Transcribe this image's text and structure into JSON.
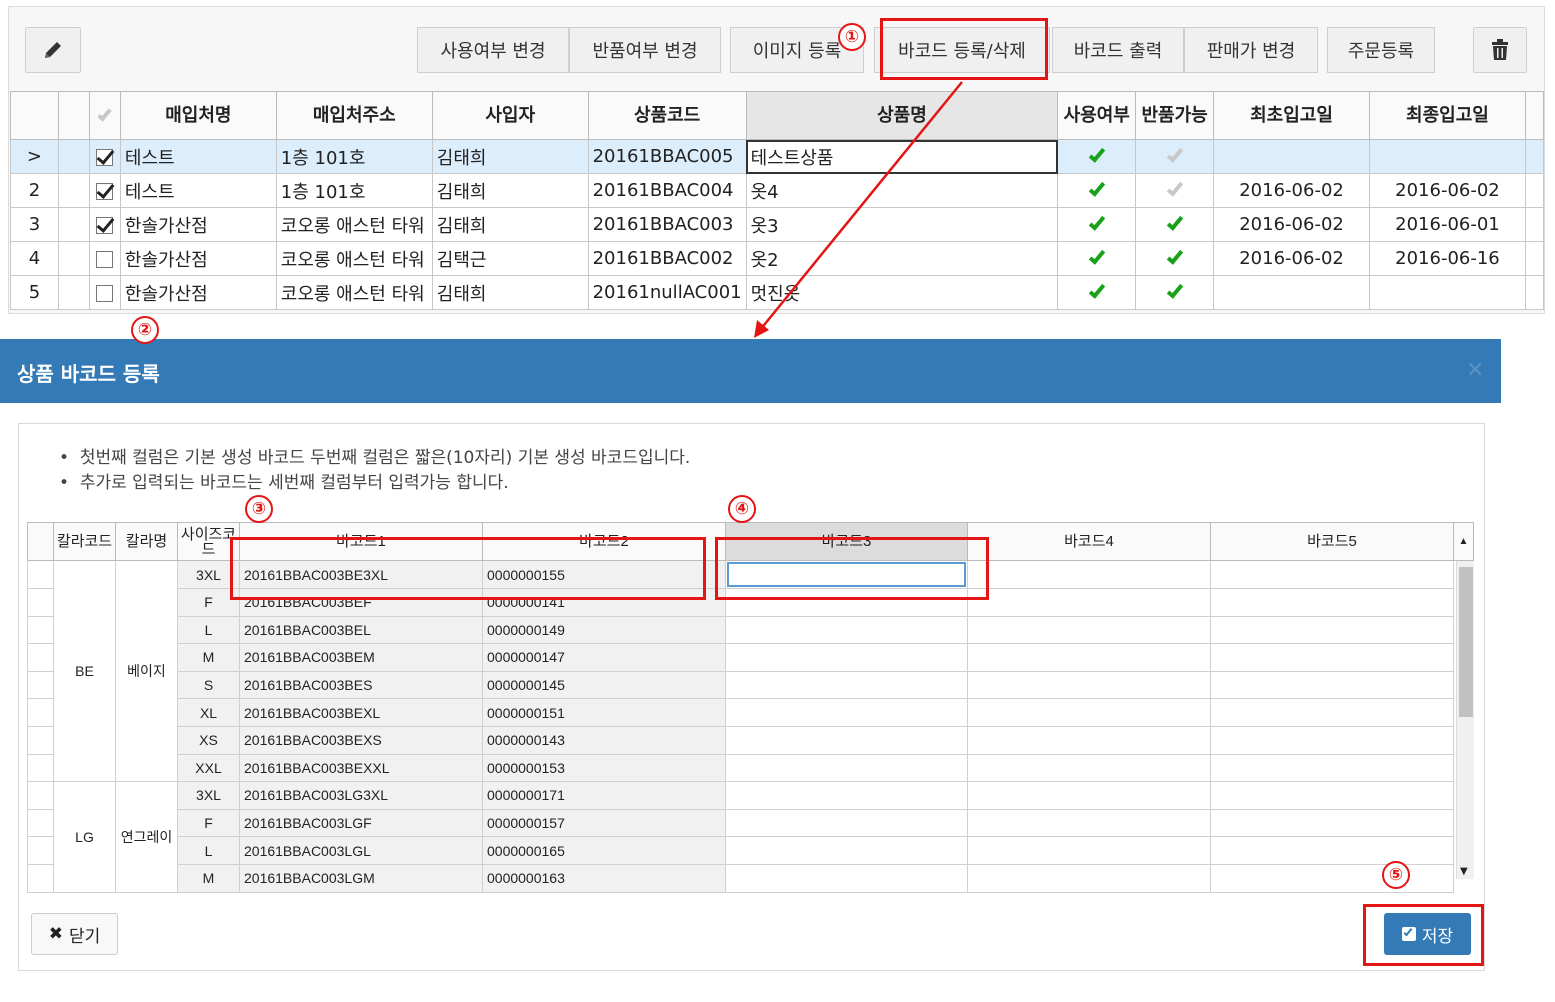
{
  "toolbar": {
    "edit_icon": "pencil-icon",
    "delete_icon": "trash-icon",
    "buttons": [
      "사용여부 변경",
      "반품여부 변경",
      "이미지 등록",
      "바코드 등록/삭제",
      "바코드 출력",
      "판매가 변경",
      "주문등록"
    ]
  },
  "product_grid": {
    "columns": [
      "매입처명",
      "매입처주소",
      "사입자",
      "상품코드",
      "상품명",
      "사용여부",
      "반품가능",
      "최초입고일",
      "최종입고일"
    ],
    "rows": [
      {
        "row_no": ">",
        "checked": true,
        "vendor": "테스트",
        "address": "1층 101호",
        "buyer": "김태희",
        "code": "20161BBAC005",
        "name": "테스트상품",
        "in_use": "yes",
        "returnable": "no",
        "first_in": "",
        "last_in": ""
      },
      {
        "row_no": "2",
        "checked": true,
        "vendor": "테스트",
        "address": "1층 101호",
        "buyer": "김태희",
        "code": "20161BBAC004",
        "name": "옷4",
        "in_use": "yes",
        "returnable": "no",
        "first_in": "2016-06-02",
        "last_in": "2016-06-02"
      },
      {
        "row_no": "3",
        "checked": true,
        "vendor": "한솔가산점",
        "address": "코오롱 애스턴 타워",
        "buyer": "김태희",
        "code": "20161BBAC003",
        "name": "옷3",
        "in_use": "yes",
        "returnable": "yes",
        "first_in": "2016-06-02",
        "last_in": "2016-06-01"
      },
      {
        "row_no": "4",
        "checked": false,
        "vendor": "한솔가산점",
        "address": "코오롱 애스턴 타워",
        "buyer": "김택근",
        "code": "20161BBAC002",
        "name": "옷2",
        "in_use": "yes",
        "returnable": "yes",
        "first_in": "2016-06-02",
        "last_in": "2016-06-16"
      },
      {
        "row_no": "5",
        "checked": false,
        "vendor": "한솔가산점",
        "address": "코오롱 애스턴 타워",
        "buyer": "김태희",
        "code": "20161nullAC001",
        "name": "멋진옷",
        "in_use": "yes",
        "returnable": "yes",
        "first_in": "",
        "last_in": ""
      }
    ]
  },
  "modal": {
    "title": "상품 바코드 등록",
    "close_symbol": "×",
    "notes": [
      "첫번째 컬럼은 기본 생성 바코드 두번째 컬럼은 짧은(10자리) 기본 생성 바코드입니다.",
      "추가로 입력되는 바코드는 세번째 컬럼부터 입력가능 합니다."
    ],
    "columns": [
      "칼라코드",
      "칼라명",
      "사이즈코드",
      "바코드1",
      "바코드2",
      "바코드3",
      "바코드4",
      "바코드5"
    ],
    "groups": [
      {
        "color_code": "BE",
        "color_name": "베이지",
        "rows": [
          {
            "size": "3XL",
            "barcode1": "20161BBAC003BE3XL",
            "barcode2": "0000000155"
          },
          {
            "size": "F",
            "barcode1": "20161BBAC003BEF",
            "barcode2": "0000000141"
          },
          {
            "size": "L",
            "barcode1": "20161BBAC003BEL",
            "barcode2": "0000000149"
          },
          {
            "size": "M",
            "barcode1": "20161BBAC003BEM",
            "barcode2": "0000000147"
          },
          {
            "size": "S",
            "barcode1": "20161BBAC003BES",
            "barcode2": "0000000145"
          },
          {
            "size": "XL",
            "barcode1": "20161BBAC003BEXL",
            "barcode2": "0000000151"
          },
          {
            "size": "XS",
            "barcode1": "20161BBAC003BEXS",
            "barcode2": "0000000143"
          },
          {
            "size": "XXL",
            "barcode1": "20161BBAC003BEXXL",
            "barcode2": "0000000153"
          }
        ]
      },
      {
        "color_code": "LG",
        "color_name": "연그레이",
        "rows": [
          {
            "size": "3XL",
            "barcode1": "20161BBAC003LG3XL",
            "barcode2": "0000000171"
          },
          {
            "size": "F",
            "barcode1": "20161BBAC003LGF",
            "barcode2": "0000000157"
          },
          {
            "size": "L",
            "barcode1": "20161BBAC003LGL",
            "barcode2": "0000000165"
          },
          {
            "size": "M",
            "barcode1": "20161BBAC003LGM",
            "barcode2": "0000000163"
          }
        ]
      }
    ],
    "close_button": "닫기",
    "save_button": "저장"
  },
  "annotations": [
    "①",
    "②",
    "③",
    "④",
    "⑤"
  ],
  "colors": {
    "header_blue": "#337ab7",
    "highlight_red": "#e31515",
    "check_green": "#19a119",
    "selected_row": "#dcedfb"
  }
}
